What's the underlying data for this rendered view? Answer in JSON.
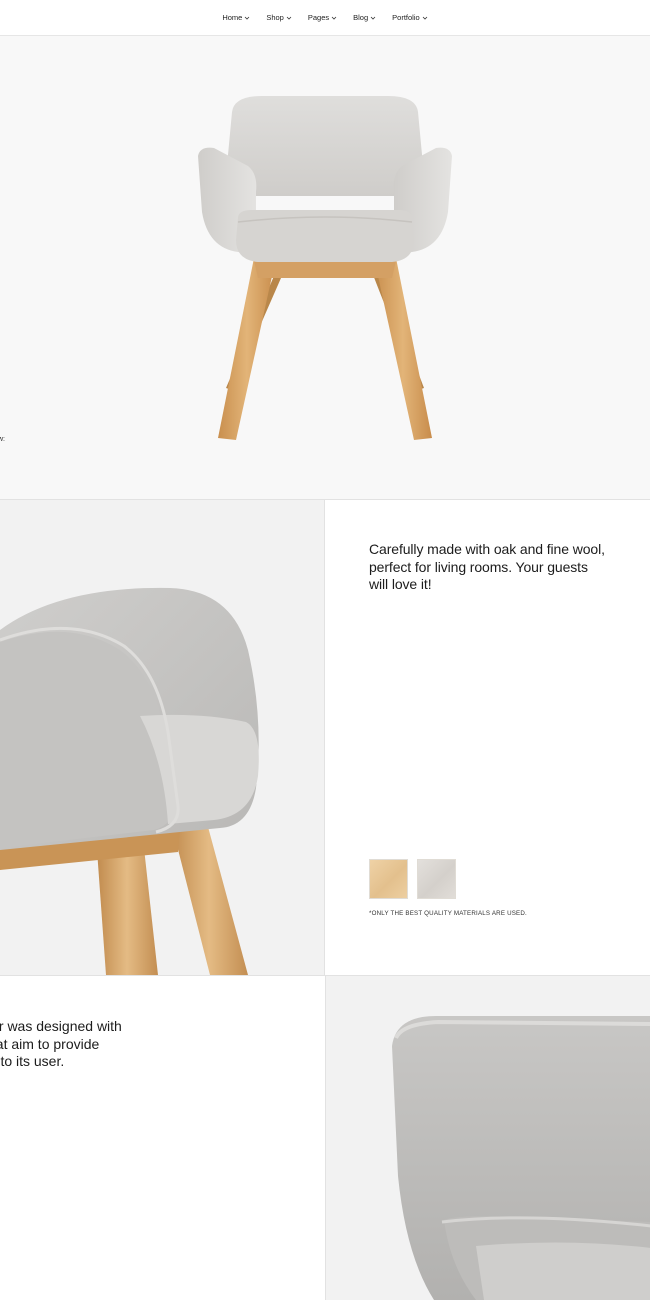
{
  "nav": {
    "items": [
      {
        "label": "Home"
      },
      {
        "label": "Shop"
      },
      {
        "label": "Pages"
      },
      {
        "label": "Blog"
      },
      {
        "label": "Portfolio"
      }
    ]
  },
  "hero": {
    "caption": "w:"
  },
  "materials": {
    "description": "Carefully made with oak and fine wool, perfect for living rooms. Your guests will love it!",
    "swatches": [
      {
        "name": "oak",
        "color": "#e8c896"
      },
      {
        "name": "wool",
        "color": "#dcd9d5"
      }
    ],
    "note": "*ONLY THE BEST QUALITY MATERIALS ARE USED."
  },
  "design": {
    "lines": [
      "air was designed with",
      "hat aim to provide",
      "rt to its user."
    ]
  },
  "colors": {
    "fabric": "#d9d8d6",
    "wood": "#d9a765",
    "background": "#f8f8f8"
  }
}
